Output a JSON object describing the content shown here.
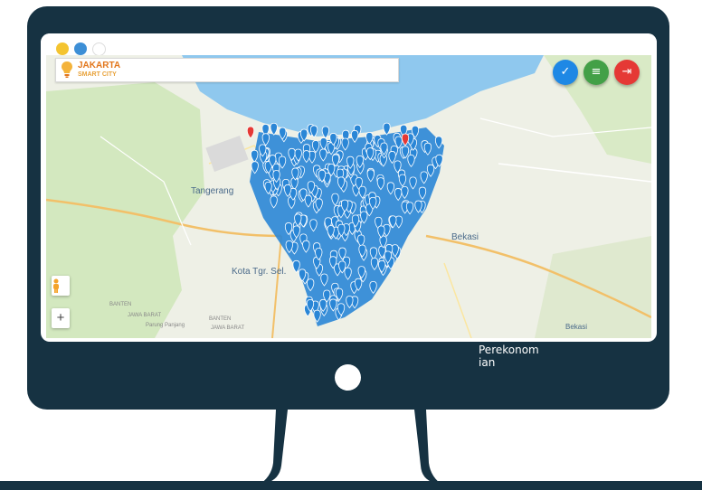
{
  "window": {
    "controls": [
      {
        "name": "minimize",
        "color": "#f4c430"
      },
      {
        "name": "maximize",
        "color": "#3d8fd6"
      },
      {
        "name": "close",
        "color": "#ffffff"
      }
    ]
  },
  "app": {
    "logo_line1": "JAKARTA",
    "logo_line2": "SMART CITY",
    "logo_icon": "lightbulb-pin-icon"
  },
  "toolbar": {
    "buttons": [
      {
        "icon": "check-icon",
        "glyph": "✓",
        "color": "#1e88e5"
      },
      {
        "icon": "list-icon",
        "glyph": "≡",
        "color": "#43a047"
      },
      {
        "icon": "exit-icon",
        "glyph": "⇥",
        "color": "#e53935"
      }
    ]
  },
  "map": {
    "labels": {
      "tangerang": "Tangerang",
      "kota_tgr_sel": "Kota Tgr. Sel.",
      "bekasi_city": "Bekasi",
      "bekasi_regency": "Bekasi",
      "banten": "BANTEN",
      "jawa_barat": "JAWA BARAT",
      "banten_small": "BANTEN",
      "jawa_barat_small": "JAWA BARAT",
      "parung_panjang": "Parung Panjang"
    },
    "controls": {
      "zoom_in": "+",
      "pegman_icon": "pegman-icon"
    },
    "colors": {
      "marker": "#2a86d6",
      "marker_alert": "#e53935",
      "sea": "#8fc8ee"
    }
  },
  "caption": "Perekonomian"
}
